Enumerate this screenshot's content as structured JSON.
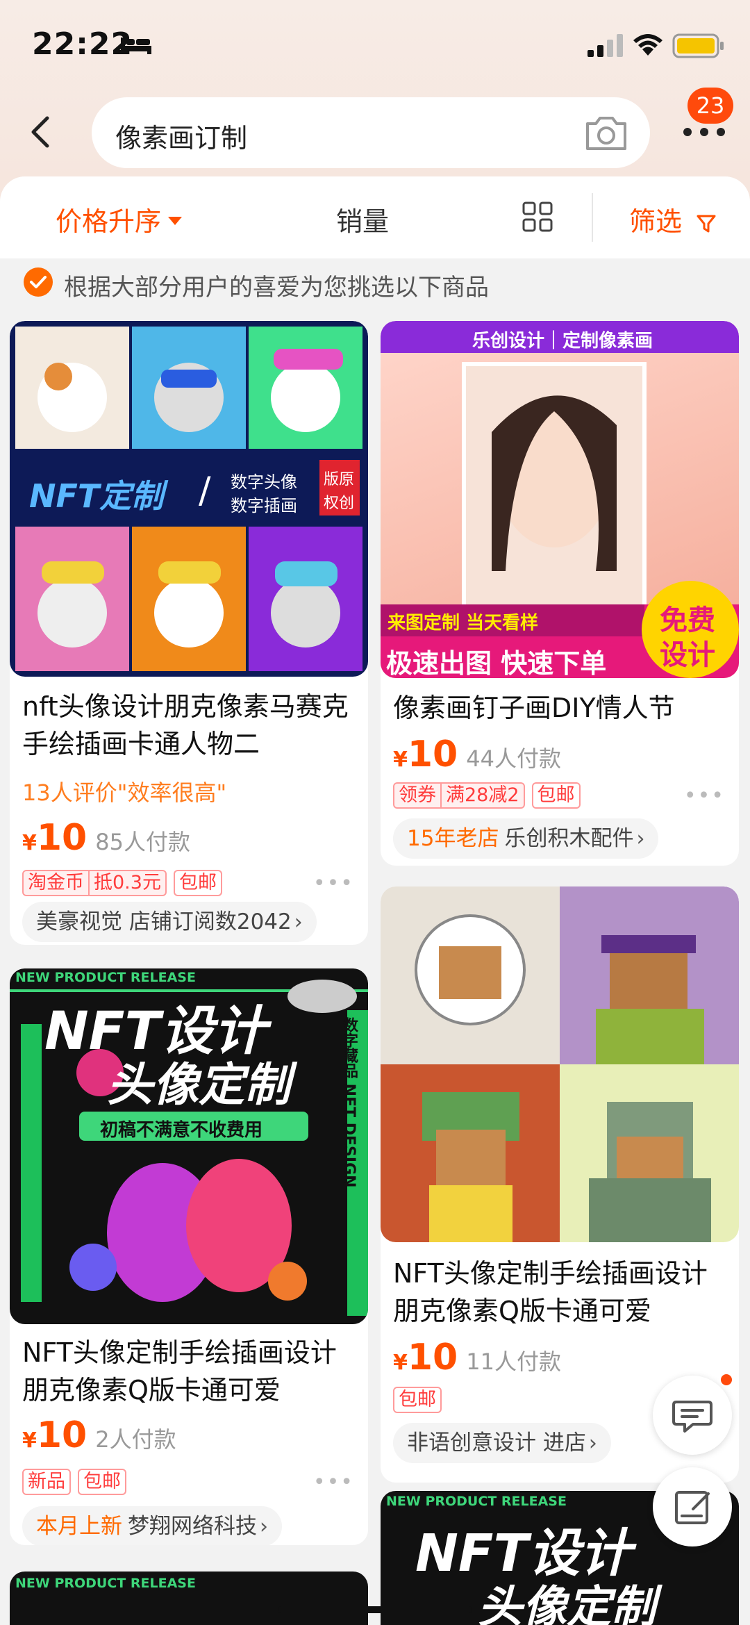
{
  "status": {
    "time": "22:22"
  },
  "search": {
    "query": "像素画订制",
    "badge": "23"
  },
  "sort": {
    "price": "价格升序",
    "sales": "销量",
    "filter": "筛选"
  },
  "tip": "根据大部分用户的喜爱为您挑选以下商品",
  "products": [
    {
      "title": "nft头像设计朋克像素马赛克手绘插画卡通人物二",
      "eval": "13人评价\"效率很高\"",
      "yen": "¥",
      "price": "10",
      "sold": "85人付款",
      "tags": [
        "淘金币",
        "抵0.3元",
        "包邮"
      ],
      "shop_highlight": "",
      "shop": "美豪视觉 店铺订阅数2042",
      "image_text": {
        "l1": "NFT定制",
        "l2": "数字头像",
        "l3": "数字插画",
        "l4": "版原",
        "l5": "权创"
      }
    },
    {
      "title": "像素画钉子画DIY情人节",
      "yen": "¥",
      "price": "10",
      "sold": "44人付款",
      "tags": [
        "领券",
        "满28减2",
        "包邮"
      ],
      "shop_highlight": "15年老店",
      "shop": "乐创积木配件",
      "image_text": {
        "top": "乐创设计｜定制像素画",
        "b1": "来图定制 当天看样",
        "b2": "极速出图 快速下单",
        "c1": "免费",
        "c2": "设计"
      }
    },
    {
      "title": "NFT头像定制手绘插画设计朋克像素Q版卡通可爱",
      "yen": "¥",
      "price": "10",
      "sold": "11人付款",
      "tags": [
        "包邮"
      ],
      "shop_highlight": "",
      "shop": "非语创意设计 进店"
    },
    {
      "title": "NFT头像定制手绘插画设计朋克像素Q版卡通可爱",
      "yen": "¥",
      "price": "10",
      "sold": "2人付款",
      "tags": [
        "新品",
        "包邮"
      ],
      "shop_highlight": "本月上新",
      "shop": "梦翔网络科技",
      "image_text": {
        "top": "NEW PRODUCT RELEASE",
        "l1": "NFT设计",
        "l2": "头像定制",
        "l3": "初稿不满意不收费用",
        "side": "数字藏品 NFT DESIGN"
      }
    }
  ],
  "colors": {
    "accent": "#ff5000",
    "badge": "#ff4a0c"
  }
}
